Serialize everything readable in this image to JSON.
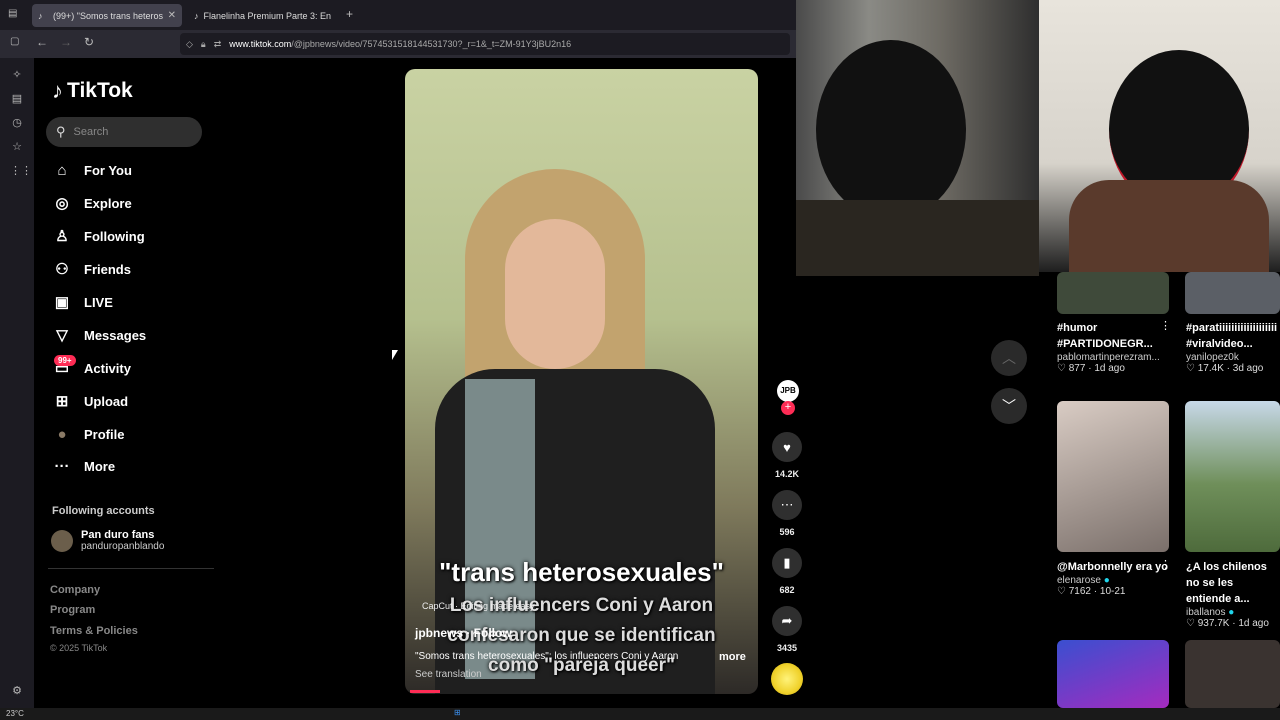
{
  "browser": {
    "tabs": [
      {
        "label": "(99+) \"Somos trans heteros",
        "active": true
      },
      {
        "label": "Flanelinha Premium Parte 3: En",
        "active": false
      }
    ],
    "new_tab": "+",
    "url_host": "www.tiktok.com",
    "url_path": "/@jpbnews/video/7574531518144531730?_r=1&_t=ZM-91Y3jBU2n16"
  },
  "nav": {
    "logo": "TikTok",
    "search_placeholder": "Search",
    "items": [
      {
        "label": "For You",
        "icon": "home-icon",
        "glyph": "⌂"
      },
      {
        "label": "Explore",
        "icon": "compass-icon",
        "glyph": "◎"
      },
      {
        "label": "Following",
        "icon": "person-plus-icon",
        "glyph": "♙"
      },
      {
        "label": "Friends",
        "icon": "friends-icon",
        "glyph": "⚇"
      },
      {
        "label": "LIVE",
        "icon": "live-tv-icon",
        "glyph": "▣"
      },
      {
        "label": "Messages",
        "icon": "paper-plane-icon",
        "glyph": "▽"
      },
      {
        "label": "Activity",
        "icon": "message-icon",
        "glyph": "▭",
        "badge": "99+"
      },
      {
        "label": "Upload",
        "icon": "upload-plus-icon",
        "glyph": "⊞"
      },
      {
        "label": "Profile",
        "icon": "profile-avatar-icon",
        "glyph": "●"
      },
      {
        "label": "More",
        "icon": "more-dots-icon",
        "glyph": "···"
      }
    ],
    "following_title": "Following accounts",
    "following": [
      {
        "name": "Pan duro fans",
        "handle": "panduropanblando"
      }
    ],
    "footer": [
      "Company",
      "Program",
      "Terms & Policies"
    ],
    "copyright": "© 2025 TikTok"
  },
  "video": {
    "caption_line1": "\"trans heterosexuales\"",
    "caption_line2": "Los influencers Coni y Aaron",
    "caption_line3": "confesaron que se identifican",
    "caption_line4": "como \"pareja queer\"",
    "capcut": "CapCut · Editing made easy",
    "author": "jpbnews · Follow",
    "description": "\"Somos trans heterosexuales\": los influencers Coni y Aaron",
    "more": "more",
    "see_translation": "See translation",
    "profile_initials": "JPB"
  },
  "actions": {
    "likes": "14.2K",
    "comments": "596",
    "saves": "682",
    "shares": "3435"
  },
  "grid": [
    {
      "title": "#humor #PARTIDONEGR...",
      "user": "pablomartinperezram...",
      "likes": "877",
      "age": "1d ago",
      "thumb": "#3f4a3a"
    },
    {
      "title": "#paratiiiiiiiiiiiiiiiiiii #viralvideo...",
      "user": "yanilopez0k",
      "likes": "17.4K",
      "age": "3d ago",
      "thumb": "#5b5f66"
    },
    {
      "title": "@Marbonnelly era yo",
      "user": "elenarose",
      "likes": "7162",
      "age": "10-21",
      "thumb": "#b7a9a0"
    },
    {
      "title": "¿A los chilenos no se les entiende a...",
      "user": "iballanos",
      "likes": "937.7K",
      "age": "1d ago",
      "thumb": "#6f8f5a"
    }
  ],
  "taskbar": {
    "temp": "23°C"
  },
  "colors": {
    "accent": "#fe2c55",
    "bg": "#000000"
  }
}
